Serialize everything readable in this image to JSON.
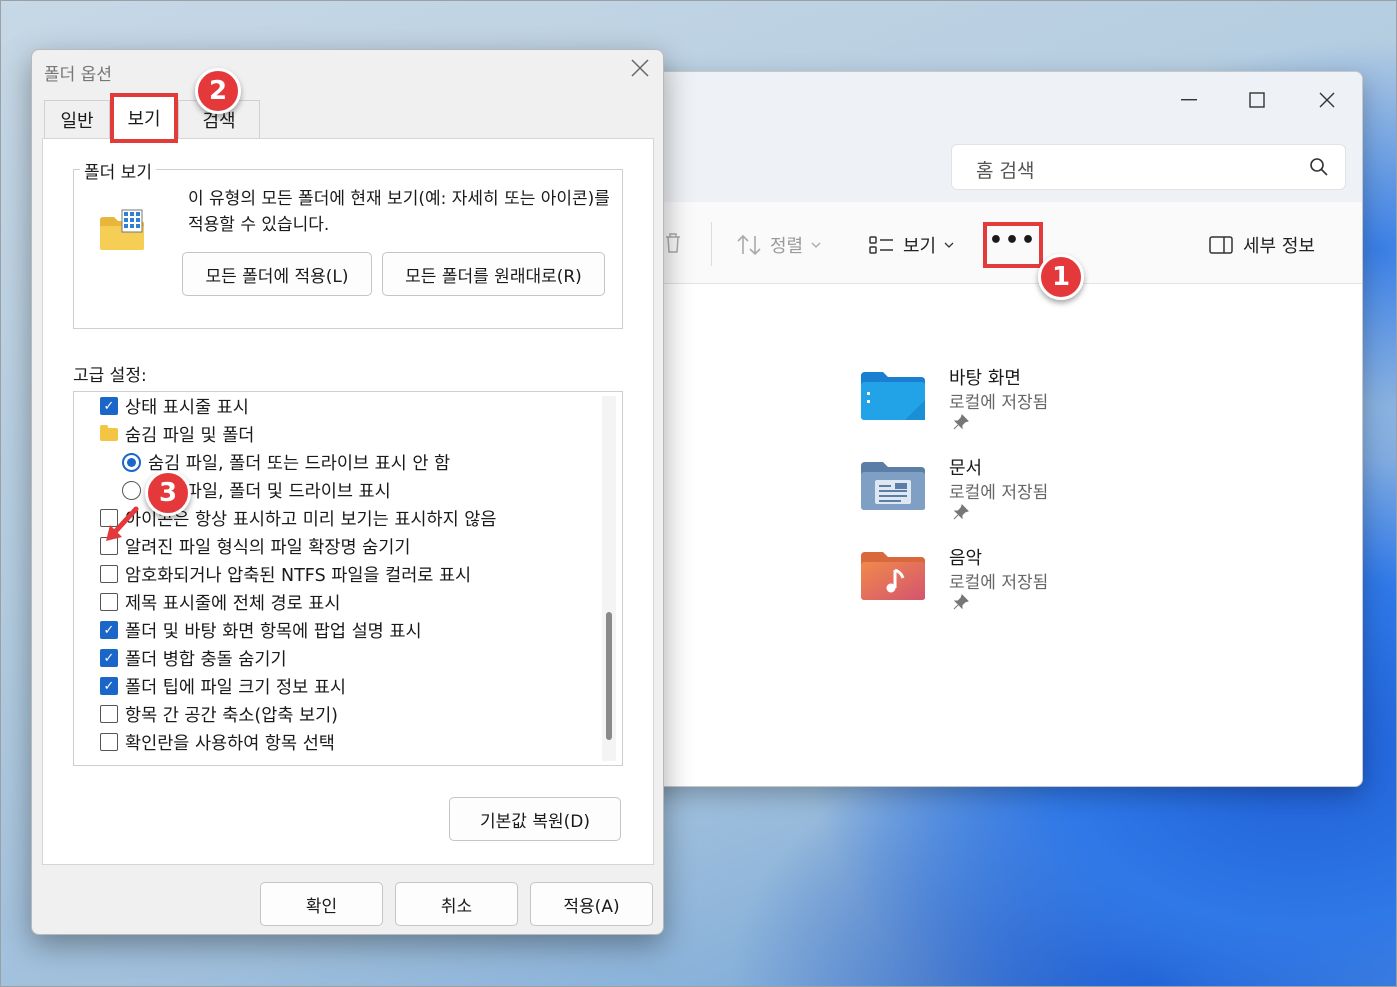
{
  "explorer": {
    "search_placeholder": "홈 검색",
    "toolbar": {
      "sort_label": "정렬",
      "view_label": "보기",
      "more_label": "•••",
      "details_label": "세부 정보"
    },
    "window_controls": {
      "minimize": "—",
      "maximize": "☐",
      "close": "✕"
    },
    "quick_access": [
      {
        "name": "바탕 화면",
        "sub": "로컬에 저장됨",
        "icon": "desktop-folder-icon",
        "color": "#1e9be0"
      },
      {
        "name": "문서",
        "sub": "로컬에 저장됨",
        "icon": "documents-folder-icon",
        "color": "#6a8fb7"
      },
      {
        "name": "음악",
        "sub": "로컬에 저장됨",
        "icon": "music-folder-icon",
        "color": "#e36b5b"
      }
    ]
  },
  "dialog": {
    "title": "폴더 옵션",
    "close": "✕",
    "tabs": [
      {
        "label": "일반"
      },
      {
        "label": "보기"
      },
      {
        "label": "검색"
      }
    ],
    "folder_view": {
      "legend": "폴더 보기",
      "description": "이 유형의 모든 폴더에 현재 보기(예: 자세히 또는 아이콘)를 적용할 수 있습니다.",
      "apply_all": "모든 폴더에 적용(L)",
      "reset_all": "모든 폴더를 원래대로(R)"
    },
    "advanced_label": "고급 설정:",
    "advanced": [
      {
        "type": "checkbox",
        "checked": true,
        "label": "상태 표시줄 표시"
      },
      {
        "type": "folder",
        "label": "숨김 파일 및 폴더"
      },
      {
        "type": "radio",
        "checked": true,
        "label": "숨김 파일, 폴더 또는 드라이브 표시 안 함"
      },
      {
        "type": "radio",
        "checked": false,
        "label": "숨김 파일, 폴더 및 드라이브 표시"
      },
      {
        "type": "checkbox",
        "checked": false,
        "label": "아이콘은 항상 표시하고 미리 보기는 표시하지 않음"
      },
      {
        "type": "checkbox",
        "checked": false,
        "label": "알려진 파일 형식의 파일 확장명 숨기기"
      },
      {
        "type": "checkbox",
        "checked": false,
        "label": "암호화되거나 압축된 NTFS 파일을 컬러로 표시"
      },
      {
        "type": "checkbox",
        "checked": false,
        "label": "제목 표시줄에 전체 경로 표시"
      },
      {
        "type": "checkbox",
        "checked": true,
        "label": "폴더 및 바탕 화면 항목에 팝업 설명 표시"
      },
      {
        "type": "checkbox",
        "checked": true,
        "label": "폴더 병합 충돌 숨기기"
      },
      {
        "type": "checkbox",
        "checked": true,
        "label": "폴더 팁에 파일 크기 정보 표시"
      },
      {
        "type": "checkbox",
        "checked": false,
        "label": "항목 간 공간 축소(압축 보기)"
      },
      {
        "type": "checkbox",
        "checked": false,
        "label": "확인란을 사용하여 항목 선택"
      }
    ],
    "restore_defaults": "기본값 복원(D)",
    "ok": "확인",
    "cancel": "취소",
    "apply": "적용(A)"
  },
  "annotations": {
    "step1": "1",
    "step2": "2",
    "step3": "3",
    "highlight_color": "#e23b3b"
  }
}
